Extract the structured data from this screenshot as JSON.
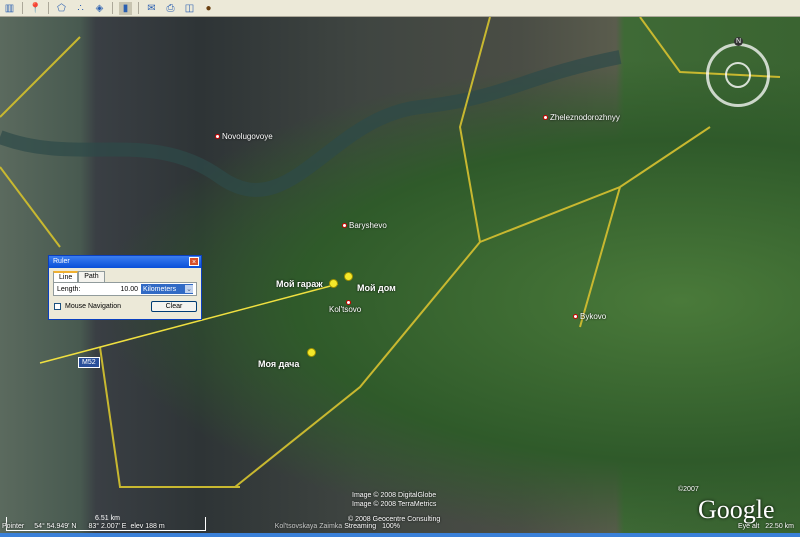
{
  "toolbar": {
    "icons": [
      "sidebar-toggle-icon",
      "placemark-icon",
      "polygon-icon",
      "path-icon",
      "overlay-icon",
      "ruler-icon",
      "email-icon",
      "print-icon",
      "maps-icon",
      "sky-icon"
    ]
  },
  "places": [
    {
      "name": "Novolugovoye"
    },
    {
      "name": "Zheleznodorozhnyy"
    },
    {
      "name": "Baryshevo"
    },
    {
      "name": "Kol'tsovo"
    },
    {
      "name": "Bykovo"
    }
  ],
  "placemarks": [
    {
      "label": "Мой гараж"
    },
    {
      "label": "Мой дом"
    },
    {
      "label": "Моя дача"
    }
  ],
  "road_label": "M52",
  "ruler": {
    "title": "Ruler",
    "tabs": [
      "Line",
      "Path"
    ],
    "active_tab": "Line",
    "length_label": "Length:",
    "length_value": "10.00",
    "unit": "Kilometers",
    "mouse_nav_label": "Mouse Navigation",
    "mouse_nav_checked": false,
    "clear_label": "Clear"
  },
  "compass": {
    "north": "N"
  },
  "credits": [
    "Image © 2008 DigitalGlobe",
    "Image © 2008 TerraMetrics",
    "© 2008 Geocentre Consulting"
  ],
  "copyright_small": "©2007",
  "logo": "Google",
  "scale": "6.51 km",
  "status": {
    "pointer_label": "Pointer",
    "lat": "54° 54.949' N",
    "lon": "83° 2.007' E",
    "elev": "elev 188 m",
    "streaming": "Streaming",
    "streaming_pct": "100%",
    "eye_alt": "Eye alt   22.50 km",
    "place_hint": "Kol'tsovskaya Zaimka"
  }
}
